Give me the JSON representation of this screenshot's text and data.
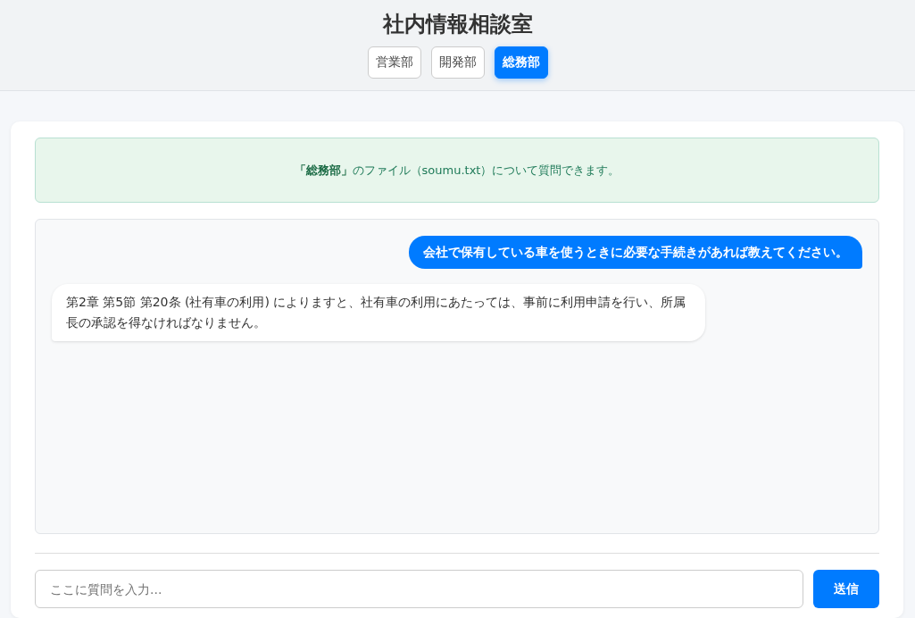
{
  "header": {
    "title": "社内情報相談室",
    "departments": [
      {
        "label": "営業部",
        "selected": false
      },
      {
        "label": "開発部",
        "selected": false
      },
      {
        "label": "総務部",
        "selected": true
      }
    ]
  },
  "notice": "**「総務部」**のファイル（soumu.txt）について質問できます。",
  "messages": [
    {
      "kind": "user",
      "text": "会社で保有している車を使うときに必要な手続きがあれば教えてください。"
    },
    {
      "kind": "bot",
      "text": "第2章 第5節 第20条 (社有車の利用) によりますと、社有車の利用にあたっては、事前に利用申請を行い、所属長の承認を得なければなりません。"
    }
  ],
  "input": {
    "placeholder": "ここに質問を入力..."
  },
  "send_button": "送信"
}
